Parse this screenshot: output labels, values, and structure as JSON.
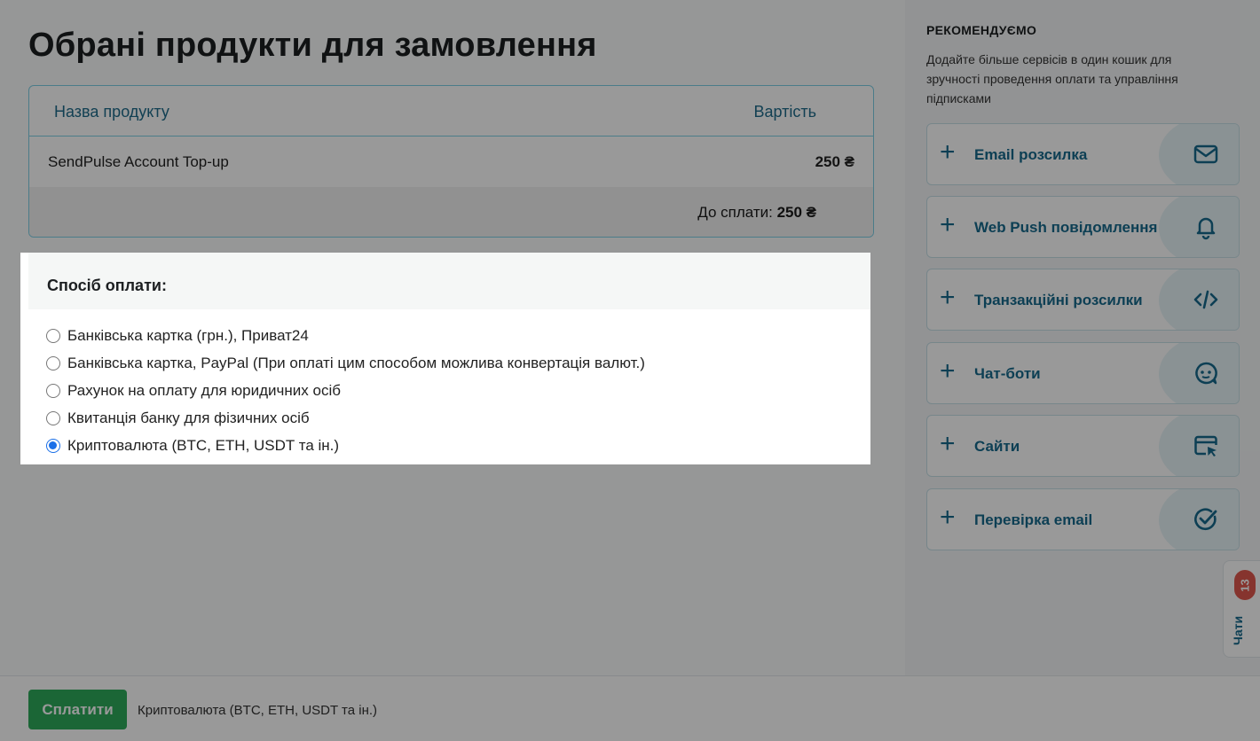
{
  "page": {
    "title": "Обрані продукти для замовлення"
  },
  "products": {
    "col_name": "Назва продукту",
    "col_price": "Вартість",
    "rows": [
      {
        "name": "SendPulse Account Top-up",
        "price": "250 ₴"
      }
    ],
    "total_label": "До сплати:",
    "total_value": "250 ₴"
  },
  "payment": {
    "heading": "Спосіб оплати:",
    "options": [
      {
        "label": "Банківська картка (грн.), Приват24",
        "selected": false
      },
      {
        "label": "Банківська картка, PayPal (При оплаті цим способом можлива конвертація валют.)",
        "selected": false
      },
      {
        "label": "Рахунок на оплату для юридичних осіб",
        "selected": false
      },
      {
        "label": "Квитанція банку для фізичних осіб",
        "selected": false
      },
      {
        "label": "Криптовалюта (BTC, ETH, USDT та ін.)",
        "selected": true
      }
    ]
  },
  "sidebar": {
    "heading": "РЕКОМЕНДУЄМО",
    "description": "Додайте більше сервісів в один кошик для зручності проведення оплати та управління підписками",
    "items": [
      {
        "label": "Email розсилка",
        "icon": "mail-icon"
      },
      {
        "label": "Web Push повідомлення",
        "icon": "bell-icon"
      },
      {
        "label": "Транзакційні розсилки",
        "icon": "code-icon"
      },
      {
        "label": "Чат-боти",
        "icon": "chat-bot-icon"
      },
      {
        "label": "Сайти",
        "icon": "website-icon"
      },
      {
        "label": "Перевірка email",
        "icon": "check-circle-icon"
      }
    ]
  },
  "chats": {
    "label": "Чати",
    "count": "13"
  },
  "footer": {
    "pay_button": "Сплатити",
    "selected_method": "Криптовалюта (BTC, ETH, USDT та ін.)"
  },
  "colors": {
    "accent": "#176a8c",
    "pay_button": "#2daa5a",
    "badge": "#e0584d",
    "radio_checked": "#1a6fe8"
  }
}
